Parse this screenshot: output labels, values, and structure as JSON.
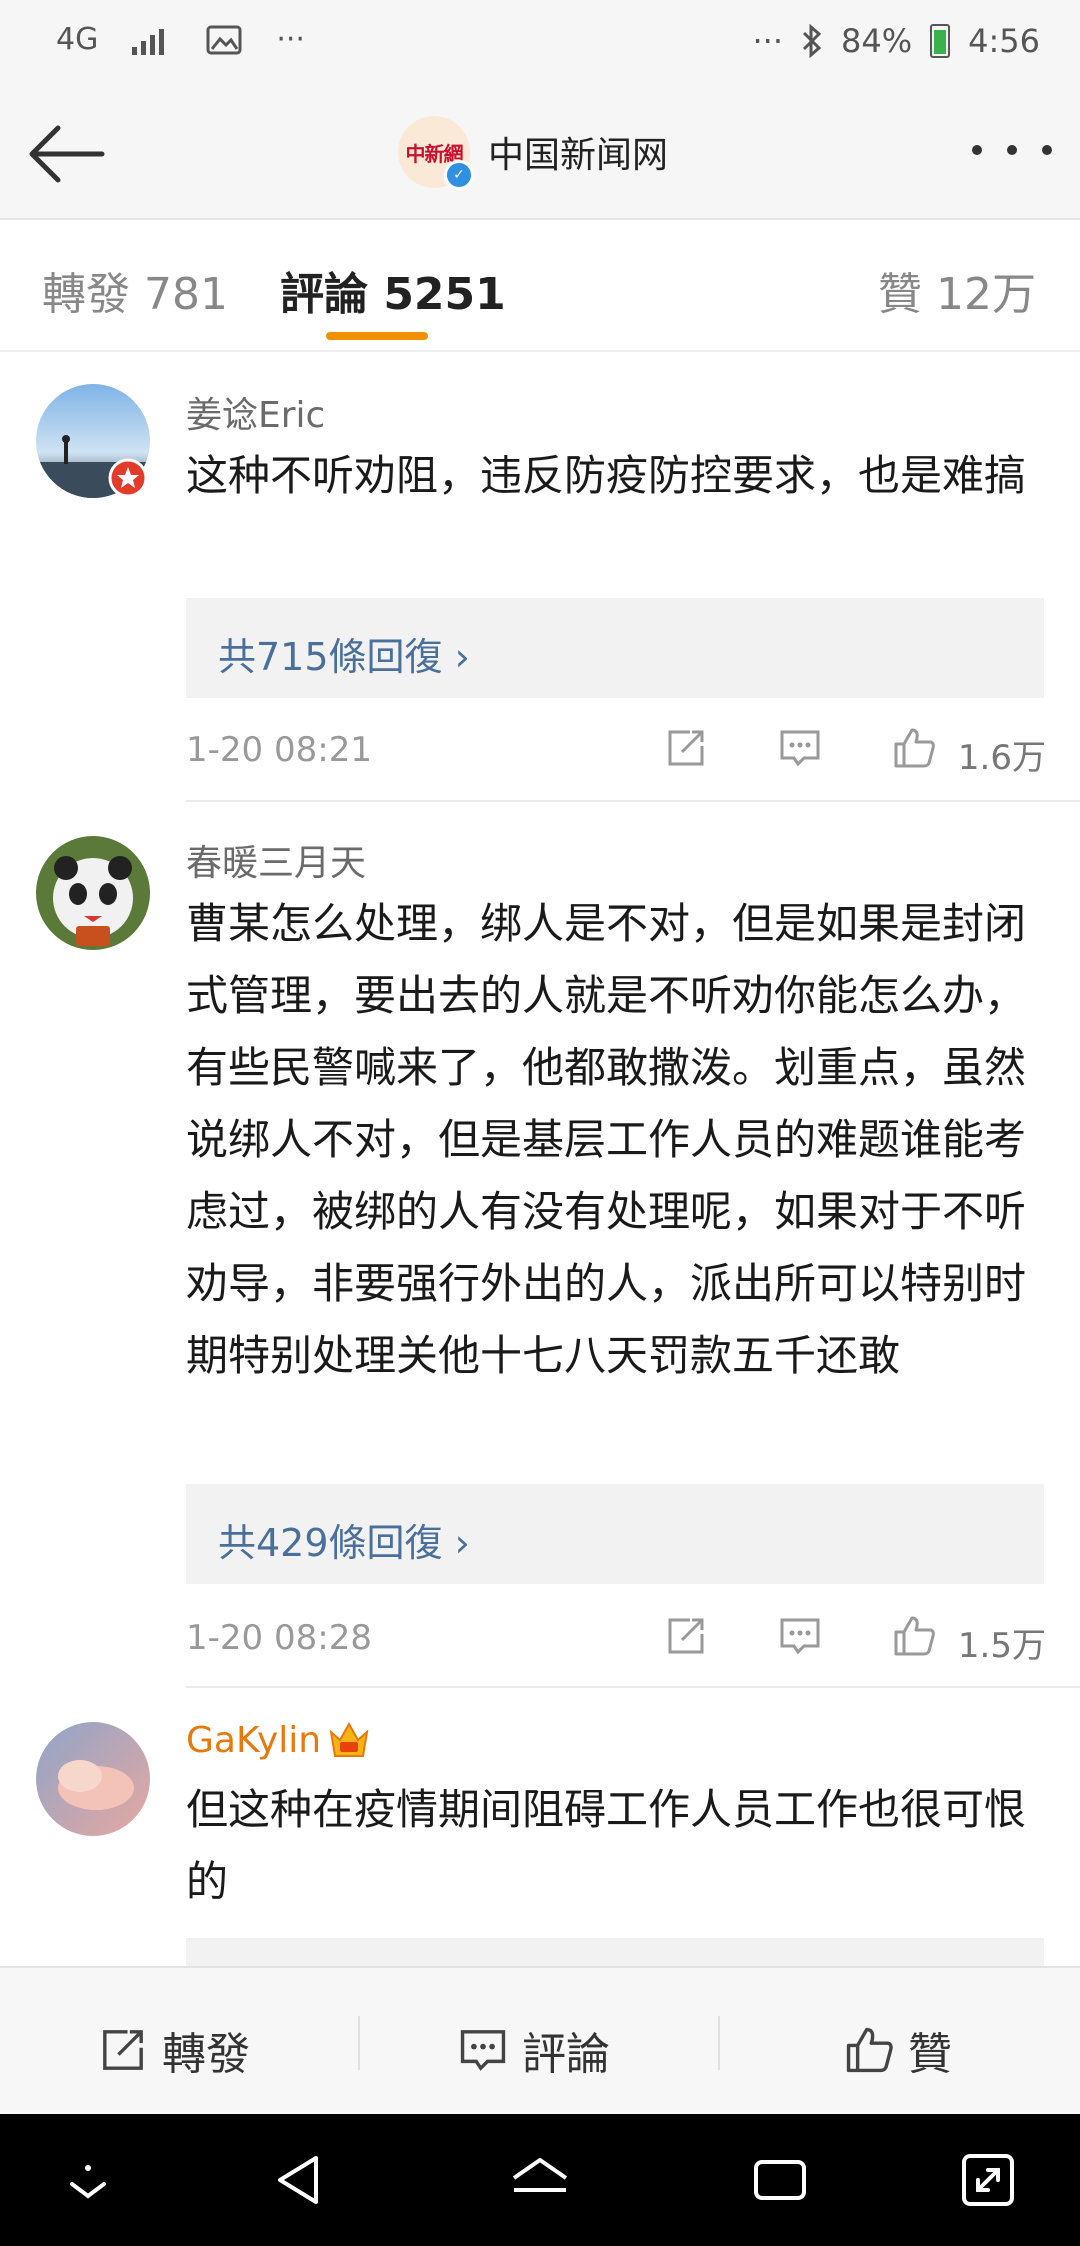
{
  "status_bar": {
    "network": "4G",
    "battery": "84%",
    "time": "4:56",
    "overflow": "···"
  },
  "header": {
    "title": "中国新闻网",
    "logo_text": "中新網"
  },
  "tabs": {
    "repost": "轉發 781",
    "comments": "評論 5251",
    "likes": "贊 12万"
  },
  "comments": [
    {
      "user": "姜谂Eric",
      "text": "这种不听劝阻，违反防疫防控要求，也是难搞",
      "replies": "共715條回復 ›",
      "time": "1-20 08:21",
      "likes": "1.6万"
    },
    {
      "user": "春暖三月天",
      "text": "曹某怎么处理，绑人是不对，但是如果是封闭式管理，要出去的人就是不听劝你能怎么办，有些民警喊来了，他都敢撒泼。划重点，虽然说绑人不对，但是基层工作人员的难题谁能考虑过，被绑的人有没有处理呢，如果对于不听劝导，非要强行外出的人，派出所可以特别时期特别处理关他十七八天罚款五千还敢",
      "replies": "共429條回復 ›",
      "time": "1-20 08:28",
      "likes": "1.5万"
    },
    {
      "user": "GaKylin",
      "text": "但这种在疫情期间阻碍工作人员工作也很可恨的"
    }
  ],
  "actions": {
    "repost": "轉發",
    "comment": "評論",
    "like": "贊"
  },
  "colors": {
    "accent": "#f29000",
    "link": "#4a6f9b",
    "vip_name": "#e8790c"
  }
}
